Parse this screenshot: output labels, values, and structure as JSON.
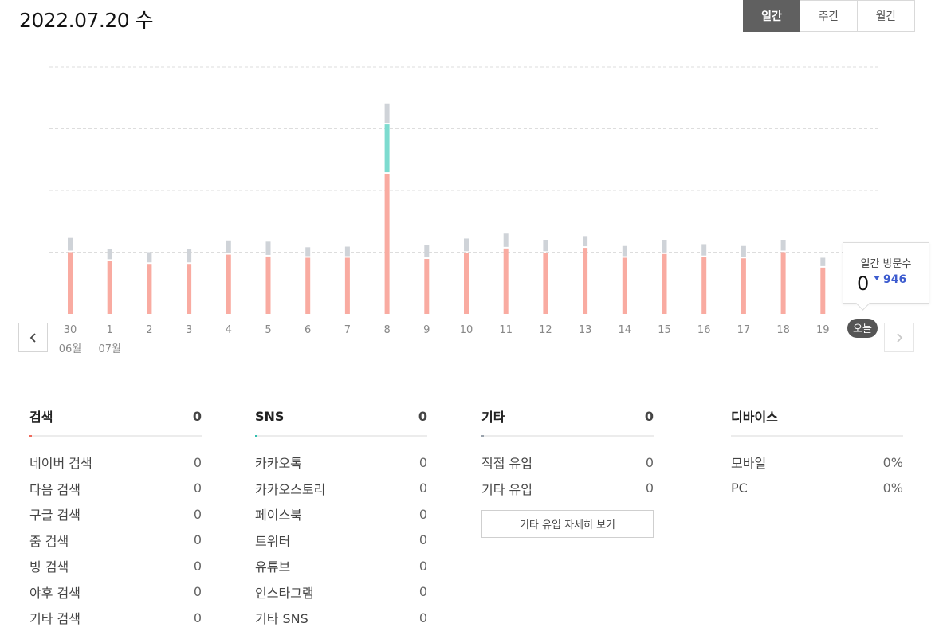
{
  "header": {
    "date_title": "2022.07.20 수"
  },
  "period_tabs": [
    {
      "label": "일간",
      "active": true
    },
    {
      "label": "주간",
      "active": false
    },
    {
      "label": "월간",
      "active": false
    }
  ],
  "colors": {
    "search": "#f9aba1",
    "sns": "#7ddbcf",
    "other": "#cfd3d8",
    "today_badge": "#555555",
    "change_down": "#3d5ccf"
  },
  "chart_data": {
    "type": "bar",
    "stacked": true,
    "categories": [
      "30",
      "1",
      "2",
      "3",
      "4",
      "5",
      "6",
      "7",
      "8",
      "9",
      "10",
      "11",
      "12",
      "13",
      "14",
      "15",
      "16",
      "17",
      "18",
      "19",
      "오늘"
    ],
    "month_labels": [
      {
        "category_index": 0,
        "label": "06월"
      },
      {
        "category_index": 1,
        "label": "07월"
      }
    ],
    "series": [
      {
        "values": [
          1000,
          860,
          810,
          810,
          960,
          930,
          910,
          910,
          2270,
          890,
          990,
          1060,
          990,
          1070,
          910,
          970,
          920,
          900,
          1000,
          750,
          0
        ]
      },
      {
        "values": [
          0,
          0,
          0,
          0,
          0,
          0,
          0,
          0,
          800,
          0,
          0,
          0,
          0,
          0,
          0,
          0,
          0,
          0,
          0,
          0,
          0
        ]
      },
      {
        "values": [
          230,
          190,
          190,
          240,
          230,
          240,
          170,
          180,
          340,
          230,
          230,
          240,
          210,
          190,
          190,
          230,
          210,
          200,
          200,
          160,
          0
        ]
      }
    ],
    "ylim": [
      0,
      4000
    ],
    "grid": true,
    "grid_values": [
      1000,
      2000,
      3000,
      4000
    ]
  },
  "tooltip": {
    "title": "일간 방문수",
    "value": "0",
    "change": "946",
    "change_direction": "down"
  },
  "stats": {
    "search": {
      "title": "검색",
      "total": "0",
      "items": [
        {
          "label": "네이버 검색",
          "value": "0"
        },
        {
          "label": "다음 검색",
          "value": "0"
        },
        {
          "label": "구글 검색",
          "value": "0"
        },
        {
          "label": "줌 검색",
          "value": "0"
        },
        {
          "label": "빙 검색",
          "value": "0"
        },
        {
          "label": "야후 검색",
          "value": "0"
        },
        {
          "label": "기타 검색",
          "value": "0"
        }
      ]
    },
    "sns": {
      "title": "SNS",
      "total": "0",
      "items": [
        {
          "label": "카카오톡",
          "value": "0"
        },
        {
          "label": "카카오스토리",
          "value": "0"
        },
        {
          "label": "페이스북",
          "value": "0"
        },
        {
          "label": "트위터",
          "value": "0"
        },
        {
          "label": "유튜브",
          "value": "0"
        },
        {
          "label": "인스타그램",
          "value": "0"
        },
        {
          "label": "기타 SNS",
          "value": "0"
        }
      ]
    },
    "other": {
      "title": "기타",
      "total": "0",
      "items": [
        {
          "label": "직접 유입",
          "value": "0"
        },
        {
          "label": "기타 유입",
          "value": "0"
        }
      ],
      "detail_button": "기타 유입 자세히 보기"
    },
    "device": {
      "title": "디바이스",
      "items": [
        {
          "label": "모바일",
          "value": "0%"
        },
        {
          "label": "PC",
          "value": "0%"
        }
      ]
    }
  }
}
